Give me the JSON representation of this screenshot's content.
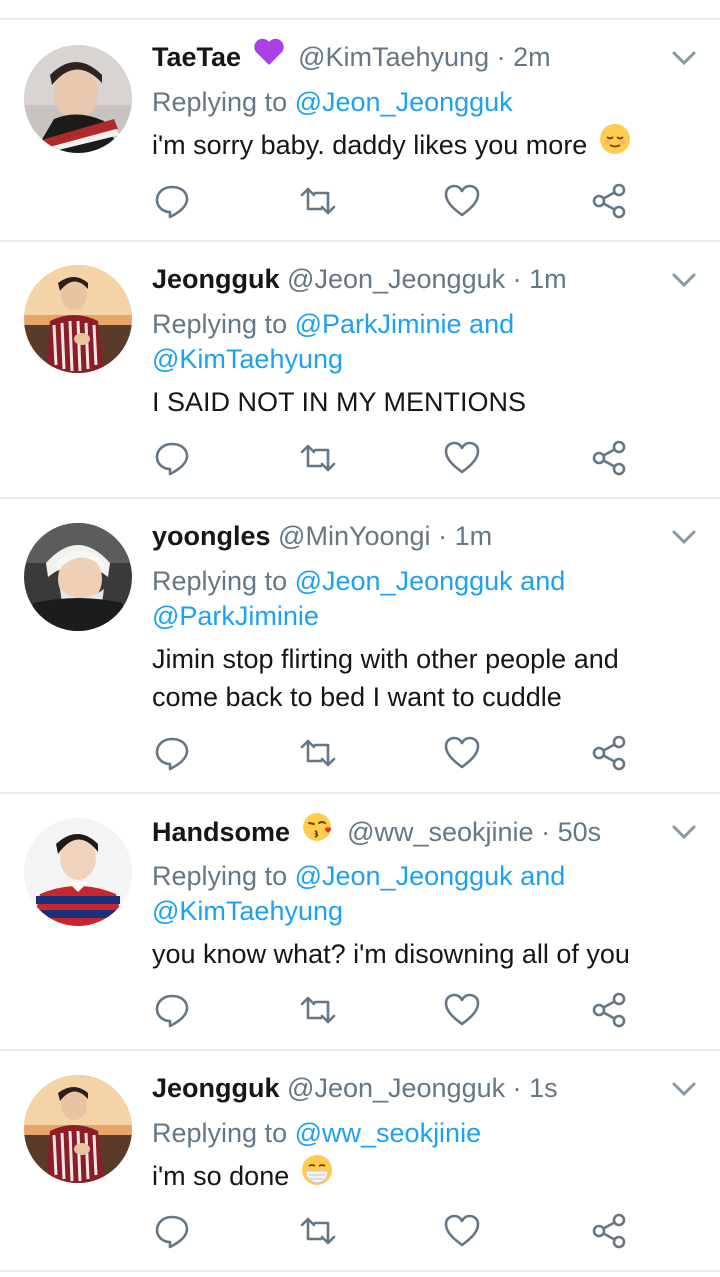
{
  "tweets": [
    {
      "display_name": "TaeTae",
      "name_emoji": "purple-heart",
      "handle": "@KimTaehyung",
      "time": "2m",
      "replying_prefix": "Replying to",
      "reply_line1": "@Jeon_Jeongguk",
      "reply_line2": "",
      "text_line1": "i'm sorry baby. daddy likes you more",
      "text_line2": "",
      "text_emoji": "relieved-face"
    },
    {
      "display_name": "Jeongguk",
      "handle": "@Jeon_Jeongguk",
      "time": "1m",
      "replying_prefix": "Replying to",
      "reply_line1": "@ParkJiminie and",
      "reply_line2": "@KimTaehyung",
      "text_line1": "I SAID NOT IN MY MENTIONS",
      "text_line2": ""
    },
    {
      "display_name": "yoongles",
      "handle": "@MinYoongi",
      "time": "1m",
      "replying_prefix": "Replying to",
      "reply_line1": "@Jeon_Jeongguk and",
      "reply_line2": "@ParkJiminie",
      "text_line1": "Jimin stop flirting with other people and",
      "text_line2": "come back to bed I want to cuddle"
    },
    {
      "display_name": "Handsome",
      "name_emoji": "face-blowing-kiss",
      "handle": "@ww_seokjinie",
      "time": "50s",
      "replying_prefix": "Replying to",
      "reply_line1": "@Jeon_Jeongguk and",
      "reply_line2": "@KimTaehyung",
      "text_line1": "you know what? i'm disowning all of you",
      "text_line2": ""
    },
    {
      "display_name": "Jeongguk",
      "handle": "@Jeon_Jeongguk",
      "time": "1s",
      "replying_prefix": "Replying to",
      "reply_line1": "@ww_seokjinie",
      "reply_line2": "",
      "text_line1": "i'm so done",
      "text_line2": "",
      "text_emoji": "face-with-medical-mask"
    }
  ],
  "icons": {
    "reply": "reply-icon",
    "retweet": "retweet-icon",
    "like": "like-icon",
    "share": "share-icon",
    "more": "chevron-down-icon"
  },
  "colors": {
    "link": "#1da1f2",
    "secondary_text": "#657786",
    "primary_text": "#14171a",
    "divider": "#e6ecf0"
  }
}
